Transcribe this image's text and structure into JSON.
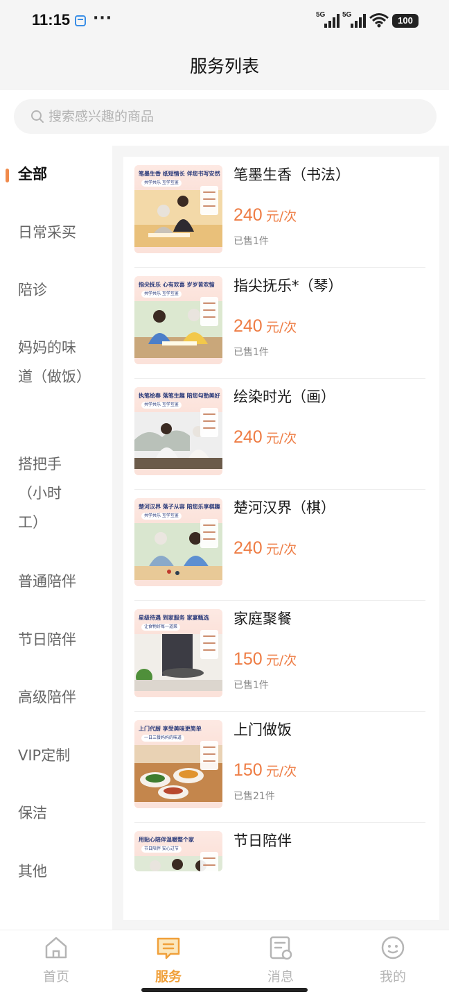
{
  "status_bar": {
    "time": "11:15",
    "dots": "···",
    "signal1": "5G",
    "signal2": "5G",
    "battery": "100"
  },
  "header": {
    "title": "服务列表"
  },
  "search": {
    "placeholder": "搜索感兴趣的商品"
  },
  "sidebar": {
    "items": [
      {
        "label": "全部",
        "active": true
      },
      {
        "label": "日常采买"
      },
      {
        "label": "陪诊"
      },
      {
        "label": "妈妈的味道（做饭）"
      },
      {
        "label": "搭把手（小时工）"
      },
      {
        "label": "普通陪伴"
      },
      {
        "label": "节日陪伴"
      },
      {
        "label": "高级陪伴"
      },
      {
        "label": "VIP定制"
      },
      {
        "label": "保洁"
      },
      {
        "label": "其他"
      }
    ]
  },
  "products": [
    {
      "name": "笔墨生香（书法）",
      "price": "240",
      "unit": "元/次",
      "sold": "已售1件",
      "thumb_title": "笔墨生香 纸短情长 伴您书写安然",
      "thumb_sub": "共学共乐 互学互鉴"
    },
    {
      "name": "指尖抚乐*（琴）",
      "price": "240",
      "unit": "元/次",
      "sold": "已售1件",
      "thumb_title": "指尖抚乐 心有欢喜 岁岁皆欢愉",
      "thumb_sub": "共学共乐 互学互鉴"
    },
    {
      "name": "绘染时光（画）",
      "price": "240",
      "unit": "元/次",
      "sold": "",
      "thumb_title": "执笔绘春 落笔生趣 陪您勾勒美好",
      "thumb_sub": "共学共乐 互学互鉴"
    },
    {
      "name": "楚河汉界（棋）",
      "price": "240",
      "unit": "元/次",
      "sold": "",
      "thumb_title": "楚河汉界 落子从容 陪您乐享棋趣",
      "thumb_sub": "共学共乐 互学互鉴"
    },
    {
      "name": "家庭聚餐",
      "price": "150",
      "unit": "元/次",
      "sold": "已售1件",
      "thumb_title": "星级待遇 到家服务 家宴甄选",
      "thumb_sub": "让食物好每一道菜"
    },
    {
      "name": "上门做饭",
      "price": "150",
      "unit": "元/次",
      "sold": "已售21件",
      "thumb_title": "上门代厨 享受美味更简单",
      "thumb_sub": "一日三餐妈妈的味道"
    },
    {
      "name": "节日陪伴",
      "price": "",
      "unit": "",
      "sold": "",
      "thumb_title": "用贴心陪伴温暖整个家",
      "thumb_sub": "节日陪伴 安心过节"
    }
  ],
  "tabbar": {
    "tabs": [
      {
        "label": "首页",
        "icon": "home-icon"
      },
      {
        "label": "服务",
        "icon": "service-icon",
        "active": true
      },
      {
        "label": "消息",
        "icon": "message-icon"
      },
      {
        "label": "我的",
        "icon": "profile-icon"
      }
    ]
  },
  "colors": {
    "accent": "#ee7d45",
    "tab_active": "#f0a03a",
    "active_marker": "#f08a4b"
  }
}
